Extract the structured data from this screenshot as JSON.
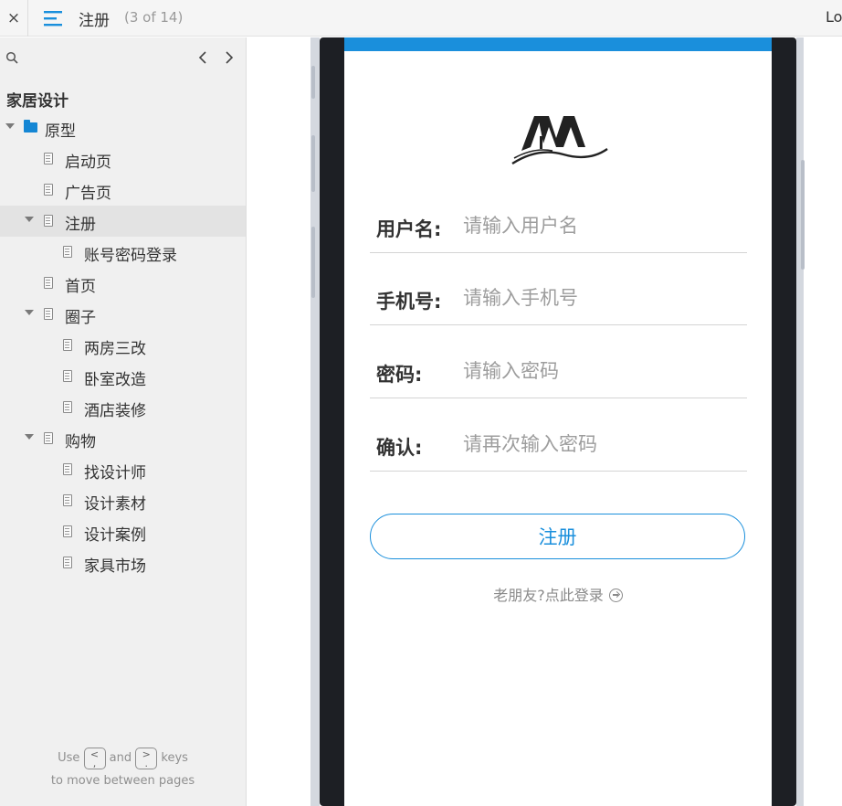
{
  "topbar": {
    "close_label": "×",
    "page_name": "注册",
    "page_count": "(3 of 14)",
    "right_link": "Lo"
  },
  "sidebar": {
    "project_title": "家居设计",
    "tree": [
      {
        "label": "原型",
        "level": 0,
        "type": "folder",
        "expanded": true
      },
      {
        "label": "启动页",
        "level": 1,
        "type": "page"
      },
      {
        "label": "广告页",
        "level": 1,
        "type": "page"
      },
      {
        "label": "注册",
        "level": 1,
        "type": "page",
        "expanded": true,
        "selected": true
      },
      {
        "label": "账号密码登录",
        "level": 2,
        "type": "page"
      },
      {
        "label": "首页",
        "level": 1,
        "type": "page"
      },
      {
        "label": "圈子",
        "level": 1,
        "type": "page",
        "expanded": true
      },
      {
        "label": "两房三改",
        "level": 2,
        "type": "page"
      },
      {
        "label": "卧室改造",
        "level": 2,
        "type": "page"
      },
      {
        "label": "酒店装修",
        "level": 2,
        "type": "page"
      },
      {
        "label": "购物",
        "level": 1,
        "type": "page",
        "expanded": true
      },
      {
        "label": "找设计师",
        "level": 2,
        "type": "page"
      },
      {
        "label": "设计素材",
        "level": 2,
        "type": "page"
      },
      {
        "label": "设计案例",
        "level": 2,
        "type": "page"
      },
      {
        "label": "家具市场",
        "level": 2,
        "type": "page"
      }
    ],
    "hint": {
      "use": "Use",
      "and": "and",
      "keys": "keys",
      "line2": "to move between pages",
      "key_prev": "<\n,",
      "key_next": ">\n."
    }
  },
  "form": {
    "fields": [
      {
        "label": "用户名:",
        "placeholder": "请输入用户名"
      },
      {
        "label": "手机号:",
        "placeholder": "请输入手机号"
      },
      {
        "label": "密码:",
        "placeholder": "请输入密码"
      },
      {
        "label": "确认:",
        "placeholder": "请再次输入密码"
      }
    ],
    "submit_label": "注册",
    "login_prompt": "老朋友?点此登录"
  },
  "colors": {
    "accent": "#1a8fdc",
    "folder": "#1486d4",
    "frame": "#1d1f24"
  }
}
